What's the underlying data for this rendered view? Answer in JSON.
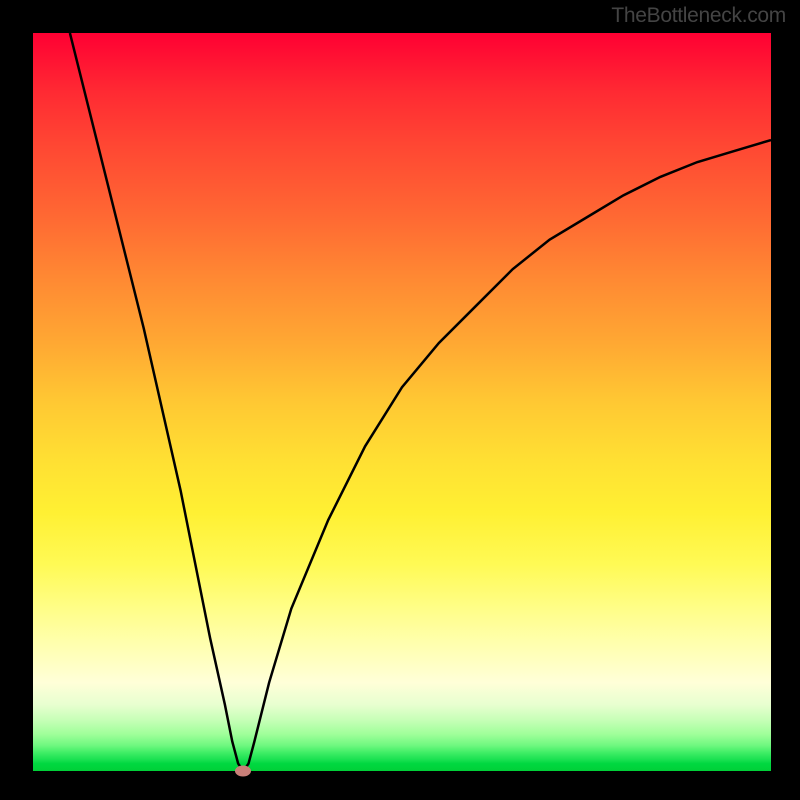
{
  "watermark": "TheBottleneck.com",
  "chart_data": {
    "type": "line",
    "title": "",
    "xlabel": "",
    "ylabel": "",
    "xlim": [
      0,
      100
    ],
    "ylim": [
      0,
      100
    ],
    "x": [
      5,
      10,
      15,
      20,
      22,
      24,
      26,
      27,
      27.8,
      28.5,
      29.2,
      30,
      32,
      35,
      40,
      45,
      50,
      55,
      60,
      65,
      70,
      75,
      80,
      85,
      90,
      95,
      100
    ],
    "y": [
      100,
      80,
      60,
      38,
      28,
      18,
      9,
      4,
      1,
      0,
      1,
      4,
      12,
      22,
      34,
      44,
      52,
      58,
      63,
      68,
      72,
      75,
      78,
      80.5,
      82.5,
      84,
      85.5
    ],
    "marker": {
      "x": 28.5,
      "y": 0
    },
    "background_gradient": [
      "#ff0033",
      "#ffc833",
      "#fff033",
      "#00d038"
    ]
  }
}
